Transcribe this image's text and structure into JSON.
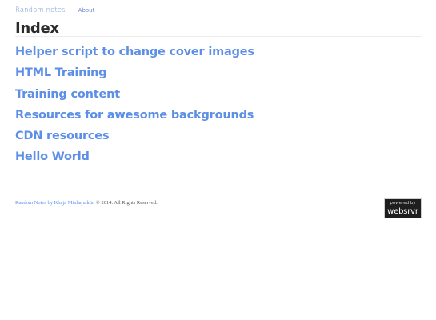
{
  "nav": {
    "brand": "Random notes",
    "about": "About"
  },
  "page": {
    "title": "Index"
  },
  "posts": [
    {
      "title": "Helper script to change cover images"
    },
    {
      "title": "HTML Training"
    },
    {
      "title": "Training content"
    },
    {
      "title": "Resources for awesome backgrounds"
    },
    {
      "title": "CDN resources"
    },
    {
      "title": "Hello World"
    }
  ],
  "footer": {
    "link_text": "Random Notes by Khaja Minhajuddin",
    "copyright": "© 2014. All Rights Reserved."
  },
  "badge": {
    "line1": "powered by",
    "line2": "websrvr"
  }
}
